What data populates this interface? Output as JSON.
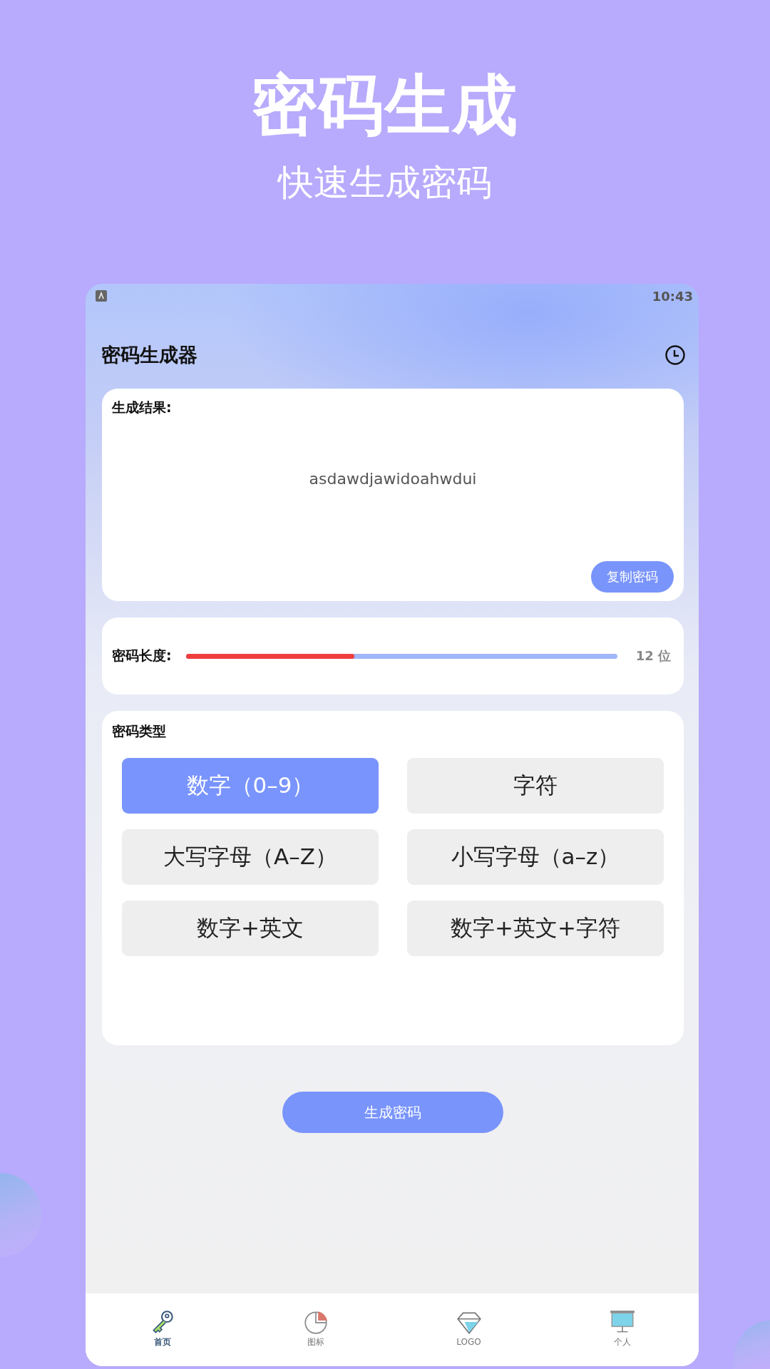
{
  "banner": {
    "title": "密码生成",
    "subtitle": "快速生成密码"
  },
  "status_bar": {
    "time": "10:43"
  },
  "app_bar": {
    "title": "密码生成器"
  },
  "result_card": {
    "label": "生成结果:",
    "password": "asdawdjawidoahwdui",
    "copy_button": "复制密码"
  },
  "length_card": {
    "label": "密码长度:",
    "level": 0.39,
    "reading": "12 位"
  },
  "type_card": {
    "label": "密码类型",
    "options": [
      {
        "label": "数字（0–9）",
        "selected": true
      },
      {
        "label": "字符",
        "selected": false
      },
      {
        "label": "大写字母（A–Z）",
        "selected": false
      },
      {
        "label": "小写字母（a–z）",
        "selected": false
      },
      {
        "label": "数字+英文",
        "selected": false
      },
      {
        "label": "数字+英文+字符",
        "selected": false
      }
    ]
  },
  "generate_button": "生成密码",
  "nav": [
    {
      "kind": "key",
      "label": "首页",
      "selected": true
    },
    {
      "kind": "pie",
      "label": "图标",
      "selected": false
    },
    {
      "kind": "diamond",
      "label": "LOGO",
      "selected": false
    },
    {
      "kind": "screen",
      "label": "个人",
      "selected": false
    }
  ]
}
